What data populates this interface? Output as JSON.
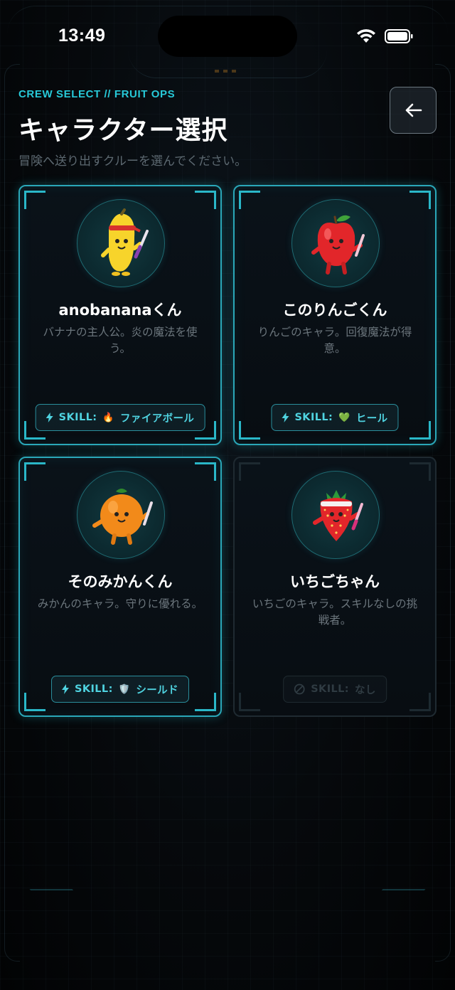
{
  "status_bar": {
    "time": "13:49"
  },
  "header": {
    "subtitle": "CREW SELECT // FRUIT OPS",
    "title": "キャラクター選択",
    "description": "冒険へ送り出すクルーを選んでください。"
  },
  "characters": [
    {
      "name": "anobananaくん",
      "description": "バナナの主人公。炎の魔法を使う。",
      "skill_prefix": "SKILL:",
      "skill_emoji": "🔥",
      "skill_name": "ファイアボール",
      "available": true,
      "avatar": "banana-character"
    },
    {
      "name": "このりんごくん",
      "description": "りんごのキャラ。回復魔法が得意。",
      "skill_prefix": "SKILL:",
      "skill_emoji": "💚",
      "skill_name": "ヒール",
      "available": true,
      "avatar": "apple-character"
    },
    {
      "name": "そのみかんくん",
      "description": "みかんのキャラ。守りに優れる。",
      "skill_prefix": "SKILL:",
      "skill_emoji": "🛡️",
      "skill_name": "シールド",
      "available": true,
      "avatar": "orange-character"
    },
    {
      "name": "いちごちゃん",
      "description": "いちごのキャラ。スキルなしの挑戦者。",
      "skill_prefix": "SKILL:",
      "skill_emoji": "",
      "skill_name": "なし",
      "available": false,
      "avatar": "strawberry-character"
    }
  ],
  "colors": {
    "accent": "#27c9d8",
    "card_border": "#2aa7b8",
    "background": "#05080b"
  }
}
